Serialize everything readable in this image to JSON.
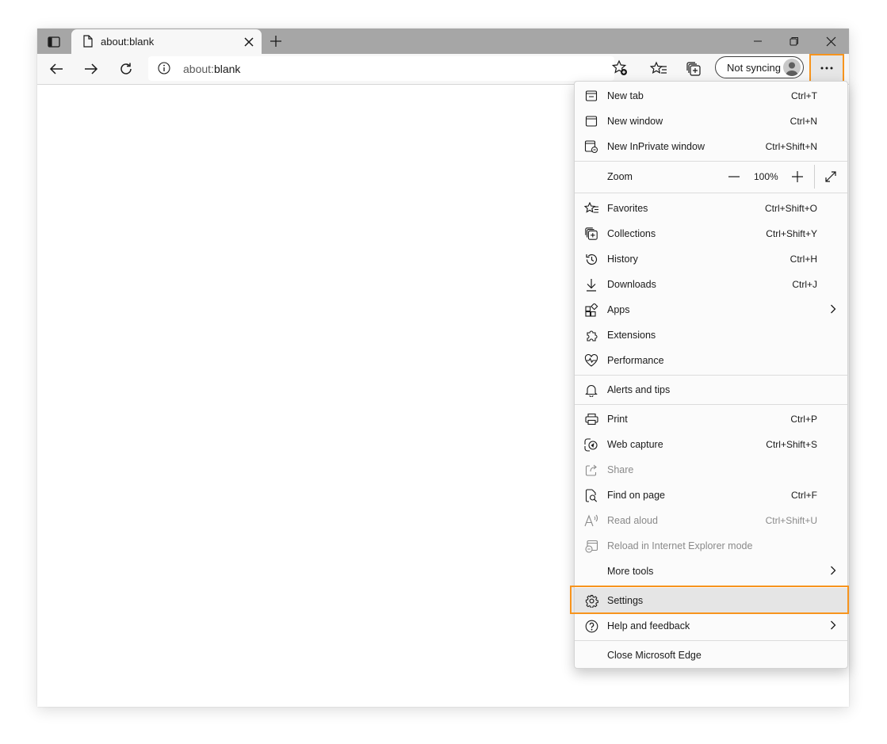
{
  "tab": {
    "title": "about:blank"
  },
  "address_bar": {
    "prefix": "about:",
    "host": "blank"
  },
  "profile": {
    "sync_label": "Not syncing"
  },
  "zoom": {
    "label": "Zoom",
    "value": "100%"
  },
  "menu": {
    "group1": [
      {
        "icon": "new-tab-icon",
        "label": "New tab",
        "shortcut": "Ctrl+T"
      },
      {
        "icon": "new-window-icon",
        "label": "New window",
        "shortcut": "Ctrl+N"
      },
      {
        "icon": "inprivate-icon",
        "label": "New InPrivate window",
        "shortcut": "Ctrl+Shift+N"
      }
    ],
    "group2": [
      {
        "icon": "favorites-icon",
        "label": "Favorites",
        "shortcut": "Ctrl+Shift+O"
      },
      {
        "icon": "collections-icon",
        "label": "Collections",
        "shortcut": "Ctrl+Shift+Y"
      },
      {
        "icon": "history-icon",
        "label": "History",
        "shortcut": "Ctrl+H"
      },
      {
        "icon": "downloads-icon",
        "label": "Downloads",
        "shortcut": "Ctrl+J"
      },
      {
        "icon": "apps-icon",
        "label": "Apps",
        "shortcut": ""
      },
      {
        "icon": "extensions-icon",
        "label": "Extensions",
        "shortcut": ""
      },
      {
        "icon": "performance-icon",
        "label": "Performance",
        "shortcut": ""
      }
    ],
    "group3": [
      {
        "icon": "bell-icon",
        "label": "Alerts and tips",
        "shortcut": ""
      }
    ],
    "group4": [
      {
        "icon": "print-icon",
        "label": "Print",
        "shortcut": "Ctrl+P"
      },
      {
        "icon": "web-capture-icon",
        "label": "Web capture",
        "shortcut": "Ctrl+Shift+S"
      },
      {
        "icon": "share-icon",
        "label": "Share",
        "shortcut": ""
      },
      {
        "icon": "find-icon",
        "label": "Find on page",
        "shortcut": "Ctrl+F"
      },
      {
        "icon": "read-aloud-icon",
        "label": "Read aloud",
        "shortcut": "Ctrl+Shift+U"
      },
      {
        "icon": "ie-mode-icon",
        "label": "Reload in Internet Explorer mode",
        "shortcut": ""
      },
      {
        "icon": "",
        "label": "More tools",
        "shortcut": ""
      }
    ],
    "group5": [
      {
        "icon": "gear-icon",
        "label": "Settings",
        "shortcut": ""
      },
      {
        "icon": "help-icon",
        "label": "Help and feedback",
        "shortcut": ""
      }
    ],
    "group6": [
      {
        "icon": "",
        "label": "Close Microsoft Edge",
        "shortcut": ""
      }
    ]
  },
  "colors": {
    "highlight_outline": "#f7941d",
    "tabstrip": "#a6a6a6",
    "toolbar": "#f7f7f7"
  }
}
